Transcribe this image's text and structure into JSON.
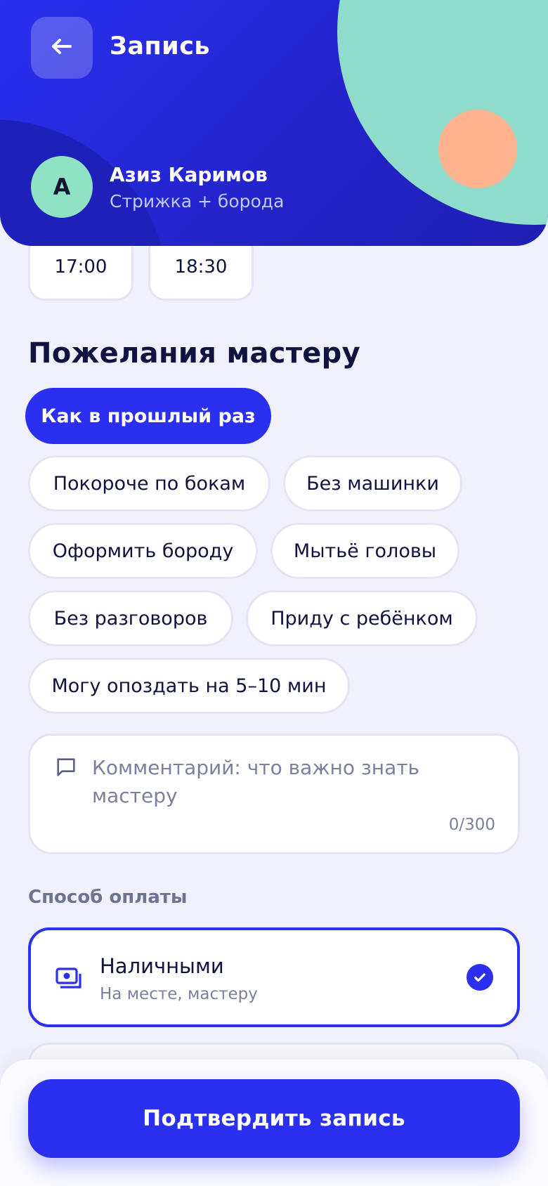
{
  "header": {
    "title": "Запись",
    "back_icon": "arrow-left-icon",
    "master": {
      "initial": "А",
      "name": "Азиз Каримов",
      "service": "Стрижка + борода"
    }
  },
  "time_slots": [
    "17:00",
    "18:30"
  ],
  "wishes": {
    "title": "Пожелания мастеру",
    "chips": [
      {
        "label": "Как в прошлый раз",
        "active": true
      },
      {
        "label": "Покороче по бокам",
        "active": false
      },
      {
        "label": "Без машинки",
        "active": false
      },
      {
        "label": "Оформить бороду",
        "active": false
      },
      {
        "label": "Мытьё головы",
        "active": false
      },
      {
        "label": "Без разговоров",
        "active": false
      },
      {
        "label": "Приду с ребёнком",
        "active": false
      },
      {
        "label": "Могу опоздать на 5–10 мин",
        "active": false
      }
    ]
  },
  "comment": {
    "icon": "message-square-icon",
    "placeholder": "Комментарий: что важно знать мастеру",
    "counter": "0/300"
  },
  "payment": {
    "label": "Способ оплаты",
    "options": [
      {
        "title": "Наличными",
        "subtitle": "На месте, мастеру",
        "icon": "cash-icon",
        "selected": true
      }
    ]
  },
  "footer": {
    "confirm_label": "Подтвердить запись"
  },
  "colors": {
    "accent": "#2b2ff0",
    "mint": "#8fdcca",
    "peach": "#ffb38f",
    "background": "#f1f1fd",
    "text": "#10123f"
  }
}
